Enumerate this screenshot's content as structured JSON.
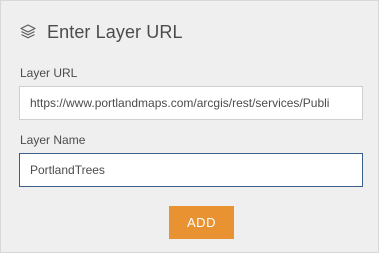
{
  "dialog": {
    "title": "Enter Layer URL",
    "title_icon": "layers-icon"
  },
  "form": {
    "url_label": "Layer URL",
    "url_value": "https://www.portlandmaps.com/arcgis/rest/services/Publi",
    "name_label": "Layer Name",
    "name_value": "PortlandTrees"
  },
  "actions": {
    "add_label": "ADD"
  },
  "colors": {
    "panel_bg": "#efefef",
    "accent": "#e99232",
    "focus_border": "#3a5f8a",
    "text": "#4c4c4c"
  }
}
